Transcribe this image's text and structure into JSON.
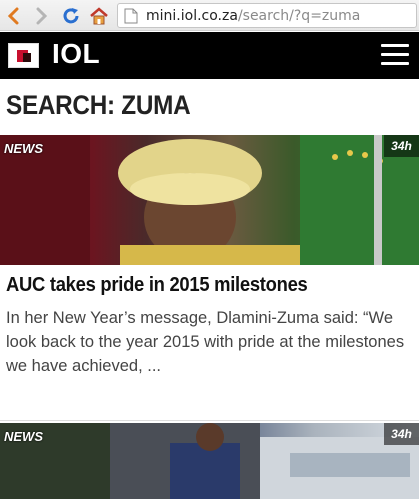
{
  "browser": {
    "url_host": "mini.iol.co.za",
    "url_path": "/search/?q=zuma"
  },
  "header": {
    "logo_text": "IOL"
  },
  "page": {
    "title": "SEARCH: ZUMA"
  },
  "articles": [
    {
      "section": "NEWS",
      "age": "34h",
      "headline": "AUC takes pride in 2015 milestones",
      "summary": "In her New Year’s message, Dlamini-Zuma said: “We look back to the year 2015 with pride at the milestones we have achieved, ..."
    },
    {
      "section": "NEWS",
      "age": "34h"
    }
  ],
  "colors": {
    "header_bg": "#000000",
    "brand_red": "#c8102e",
    "title_text": "#222222",
    "summary_text": "#444444"
  }
}
